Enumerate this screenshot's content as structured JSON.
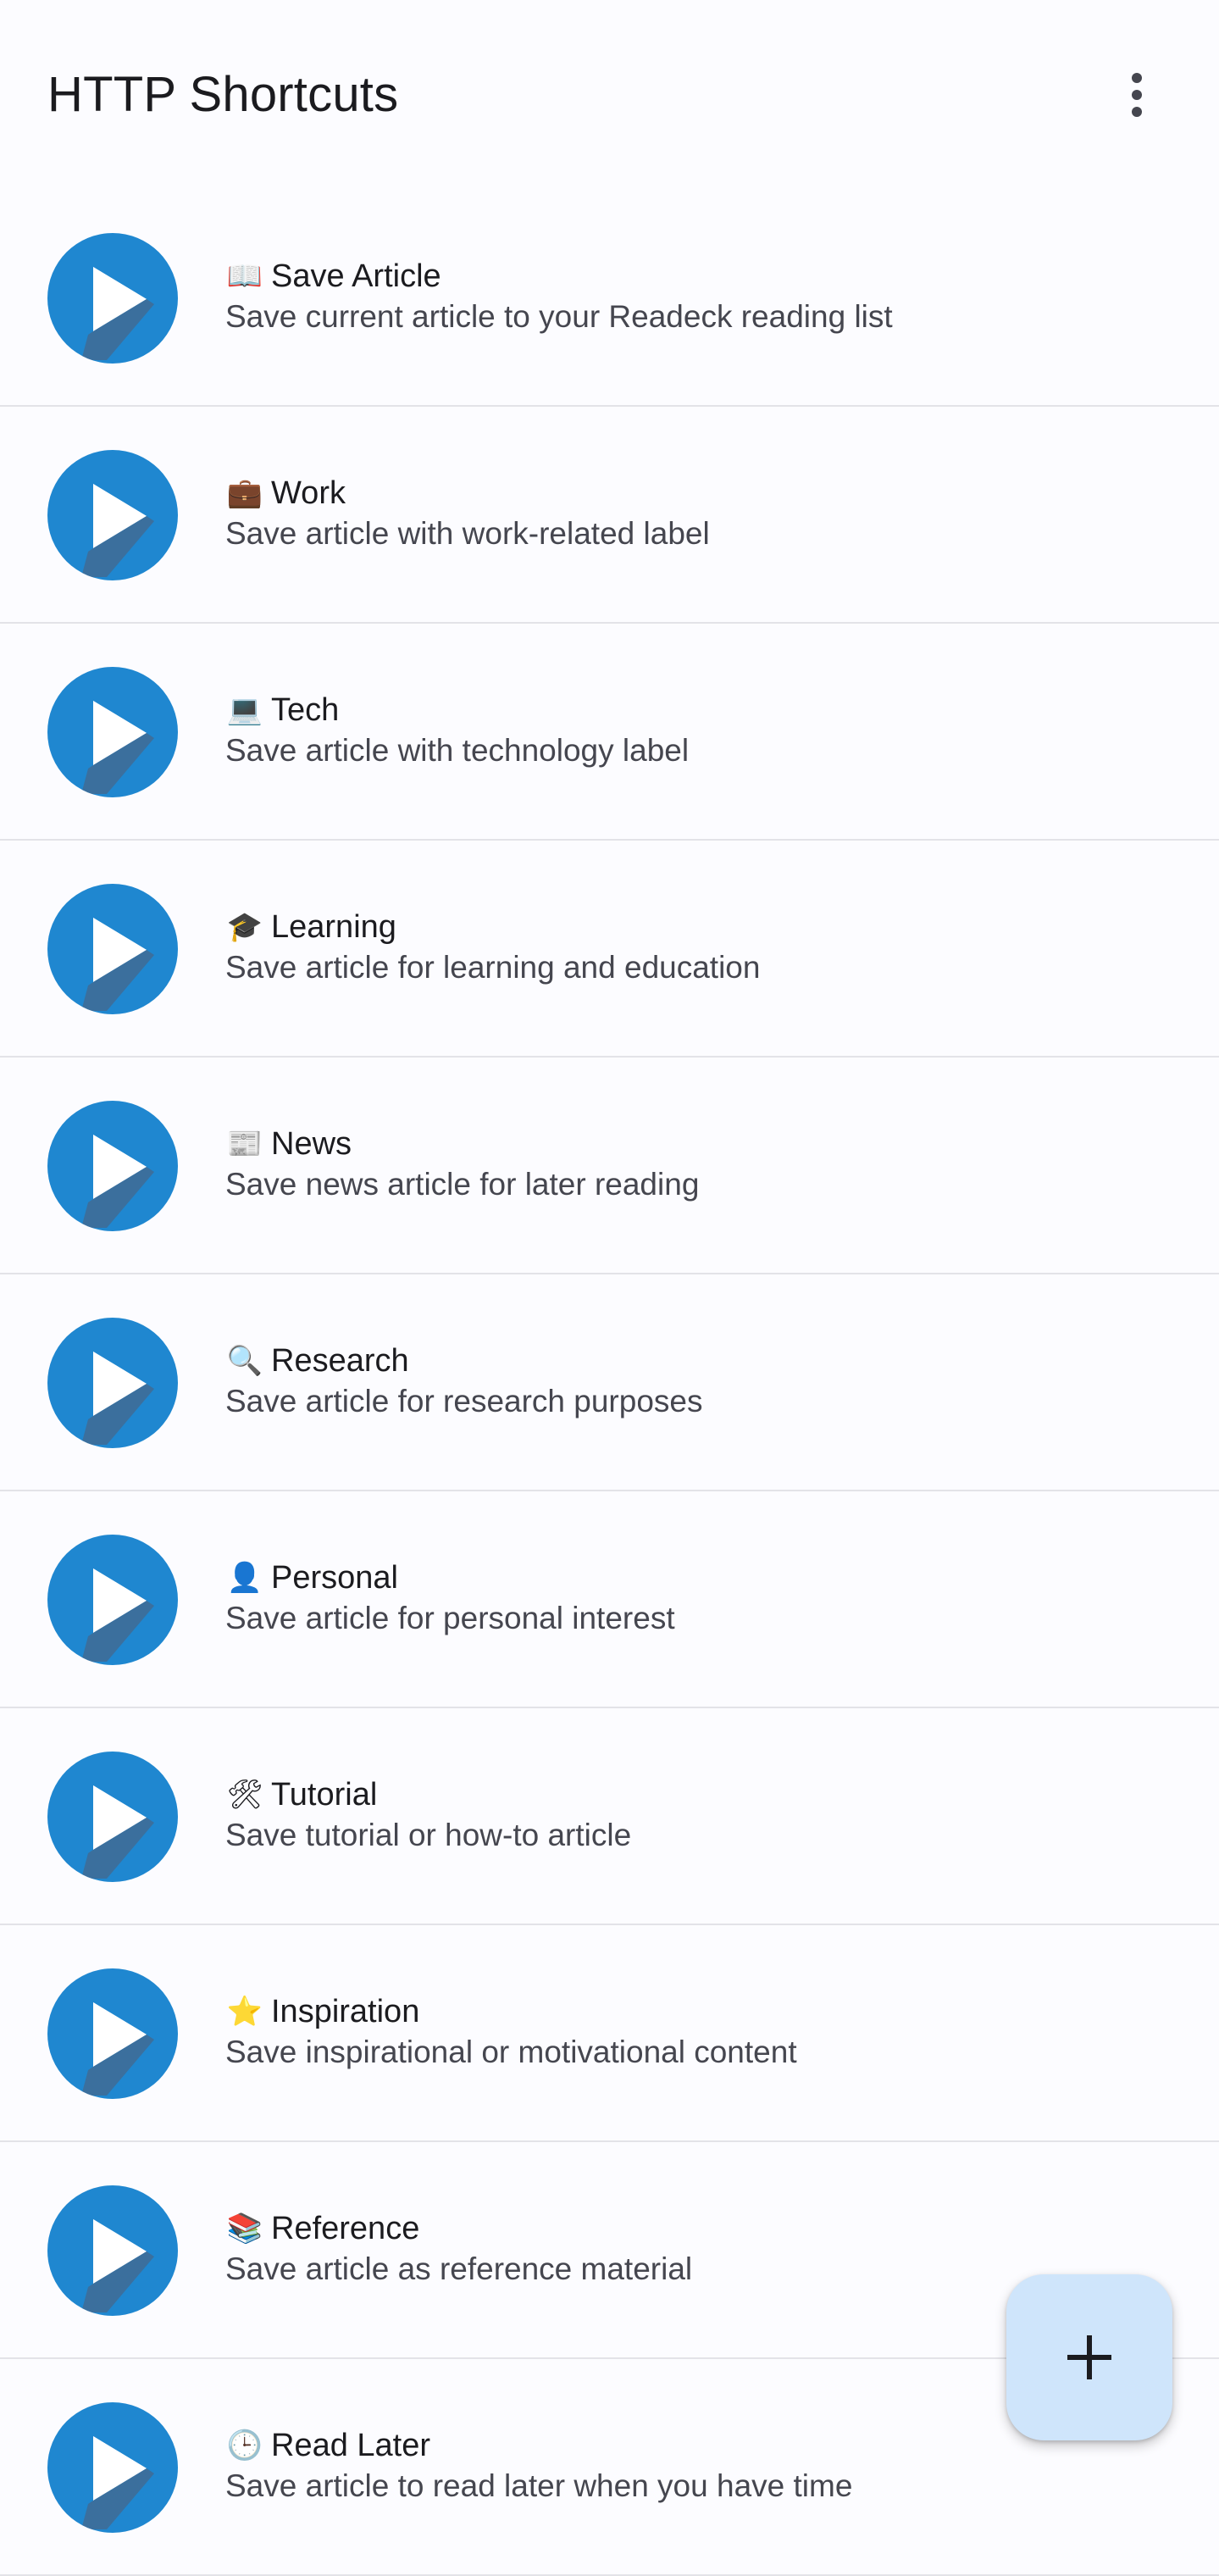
{
  "app": {
    "title": "HTTP Shortcuts",
    "overflow_icon": "more-vert-icon"
  },
  "shortcut_icon": {
    "name": "send-arrow-icon",
    "background": "#1f87d0",
    "foreground": "#ffffff",
    "shadow": "#3e6d97"
  },
  "shortcuts": [
    {
      "emoji": "📖",
      "emoji_name": "open-book-icon",
      "name": "Save Article",
      "description": "Save current article to your Readeck reading list"
    },
    {
      "emoji": "💼",
      "emoji_name": "briefcase-icon",
      "name": "Work",
      "description": "Save article with work-related label"
    },
    {
      "emoji": "💻",
      "emoji_name": "laptop-icon",
      "name": "Tech",
      "description": "Save article with technology label"
    },
    {
      "emoji": "🎓",
      "emoji_name": "graduation-cap-icon",
      "name": "Learning",
      "description": "Save article for learning and education"
    },
    {
      "emoji": "📰",
      "emoji_name": "newspaper-icon",
      "name": "News",
      "description": "Save news article for later reading"
    },
    {
      "emoji": "🔍",
      "emoji_name": "magnifier-icon",
      "name": "Research",
      "description": "Save article for research purposes"
    },
    {
      "emoji": "👤",
      "emoji_name": "person-silhouette-icon",
      "name": "Personal",
      "description": "Save article for personal interest"
    },
    {
      "emoji": "🛠",
      "emoji_name": "hammer-wrench-icon",
      "name": "Tutorial",
      "description": "Save tutorial or how-to article"
    },
    {
      "emoji": "⭐",
      "emoji_name": "star-icon",
      "name": "Inspiration",
      "description": "Save inspirational or motivational content"
    },
    {
      "emoji": "📚",
      "emoji_name": "books-icon",
      "name": "Reference",
      "description": "Save article as reference material"
    },
    {
      "emoji": "🕒",
      "emoji_name": "clock-icon",
      "name": "Read Later",
      "description": "Save article to read later when you have time"
    }
  ],
  "fab": {
    "icon": "plus-icon",
    "background": "#cfe5fb"
  }
}
